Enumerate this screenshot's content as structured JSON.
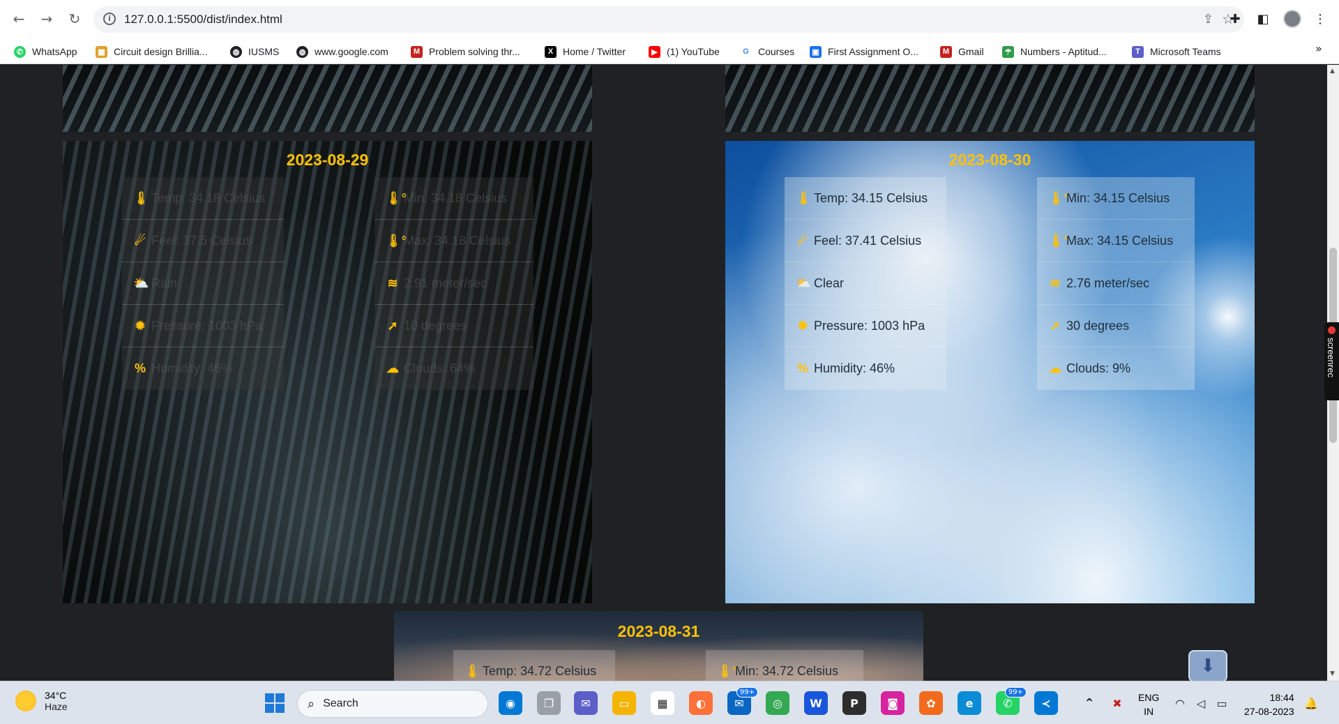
{
  "browser": {
    "url": "127.0.0.1:5500/dist/index.html",
    "bookmarks": [
      {
        "label": "WhatsApp",
        "icon": "whatsapp-icon",
        "color": "#25d366"
      },
      {
        "label": "Circuit design Brillia...",
        "icon": "circuit-icon",
        "color": "#e0a030"
      },
      {
        "label": "IUSMS",
        "icon": "globe-icon",
        "color": "#202124"
      },
      {
        "label": "www.google.com",
        "icon": "globe-icon",
        "color": "#202124"
      },
      {
        "label": "Problem solving thr...",
        "icon": "gmail-icon",
        "color": "#c5221f"
      },
      {
        "label": "Home / Twitter",
        "icon": "x-icon",
        "color": "#000000"
      },
      {
        "label": "(1) YouTube",
        "icon": "youtube-icon",
        "color": "#ff0000"
      },
      {
        "label": "Courses",
        "icon": "google-icon",
        "color": "#4285f4"
      },
      {
        "label": "First Assignment O...",
        "icon": "classroom-icon",
        "color": "#1a73e8"
      },
      {
        "label": "Gmail",
        "icon": "gmail-icon",
        "color": "#c5221f"
      },
      {
        "label": "Numbers - Aptitud...",
        "icon": "umbrella-icon",
        "color": "#2e9c4a"
      },
      {
        "label": "Microsoft Teams",
        "icon": "teams-icon",
        "color": "#5b5fc7"
      }
    ],
    "more": "»"
  },
  "cards": {
    "aug29": {
      "date": "2023-08-29",
      "left": [
        {
          "icon": "thermometer-icon",
          "glyph": "🌡",
          "text": "Temp: 34.18 Celsius"
        },
        {
          "icon": "feels-like-icon",
          "glyph": "☄",
          "text": "Feel: 37.5 Celsius"
        },
        {
          "icon": "sun-cloud-icon",
          "glyph": "⛅",
          "text": "Rain"
        },
        {
          "icon": "pressure-icon",
          "glyph": "✹",
          "text": "Pressure: 1003 hPa"
        },
        {
          "icon": "percent-icon",
          "glyph": "%",
          "text": "Humidity: 46%"
        }
      ],
      "right": [
        {
          "icon": "thermometer-deg-icon",
          "glyph": "🌡°",
          "text": "Min: 34.18 Celsius"
        },
        {
          "icon": "thermometer-deg-icon",
          "glyph": "🌡°",
          "text": "Max: 34.18 Celsius"
        },
        {
          "icon": "wind-icon",
          "glyph": "≋",
          "text": "2.91 meter/sec"
        },
        {
          "icon": "compass-icon",
          "glyph": "➚",
          "text": "10 degrees"
        },
        {
          "icon": "cloud-icon",
          "glyph": "☁",
          "text": "Clouds: 64%"
        }
      ]
    },
    "aug30": {
      "date": "2023-08-30",
      "left": [
        {
          "icon": "thermometer-icon",
          "glyph": "🌡",
          "text": "Temp: 34.15 Celsius"
        },
        {
          "icon": "feels-like-icon",
          "glyph": "☄",
          "text": "Feel: 37.41 Celsius"
        },
        {
          "icon": "sun-cloud-icon",
          "glyph": "⛅",
          "text": "Clear"
        },
        {
          "icon": "pressure-icon",
          "glyph": "✹",
          "text": "Pressure: 1003 hPa"
        },
        {
          "icon": "percent-icon",
          "glyph": "%",
          "text": "Humidity: 46%"
        }
      ],
      "right": [
        {
          "icon": "thermometer-deg-icon",
          "glyph": "🌡°",
          "text": "Min: 34.15 Celsius"
        },
        {
          "icon": "thermometer-deg-icon",
          "glyph": "🌡°",
          "text": "Max: 34.15 Celsius"
        },
        {
          "icon": "wind-icon",
          "glyph": "≋",
          "text": "2.76 meter/sec"
        },
        {
          "icon": "compass-icon",
          "glyph": "➚",
          "text": "30 degrees"
        },
        {
          "icon": "cloud-icon",
          "glyph": "☁",
          "text": "Clouds: 9%"
        }
      ]
    },
    "aug31": {
      "date": "2023-08-31",
      "left": [
        {
          "icon": "thermometer-icon",
          "glyph": "🌡",
          "text": "Temp: 34.72 Celsius"
        }
      ],
      "right": [
        {
          "icon": "thermometer-deg-icon",
          "glyph": "🌡°",
          "text": "Min: 34.72 Celsius"
        }
      ]
    }
  },
  "accent": "#ffc107",
  "screenrec": "screenrec",
  "taskbar": {
    "weather_temp": "34°C",
    "weather_desc": "Haze",
    "search_label": "Search",
    "apps_badge_1": "99+",
    "apps_badge_2": "99+",
    "lang_top": "ENG",
    "lang_bottom": "IN",
    "time": "18:44",
    "date": "27-08-2023"
  }
}
